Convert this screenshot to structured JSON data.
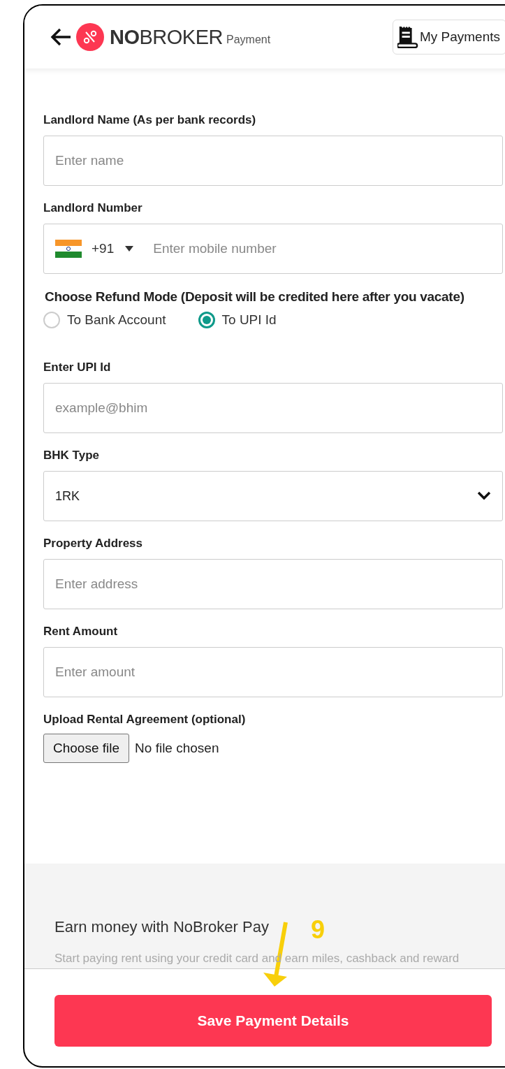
{
  "header": {
    "logo": "**NO**BROKER",
    "subtitle": "Payment",
    "my_payments": "My Payments"
  },
  "fields": [
    {
      "kind": "text",
      "label": "Landlord Name (As per bank records)",
      "placeholder": "Enter name"
    },
    {
      "kind": "phone",
      "label": "Landlord Number",
      "country_code": "+91",
      "placeholder": "Enter mobile number"
    },
    {
      "kind": "radio",
      "label": "Choose Refund Mode (Deposit will be credited here after you vacate)",
      "options": [
        {
          "label": "To Bank Account",
          "selected": false
        },
        {
          "label": "To UPI Id",
          "selected": true
        }
      ]
    },
    {
      "kind": "text",
      "label": "Enter UPI Id",
      "placeholder": "example@bhim"
    },
    {
      "kind": "select",
      "label": "BHK Type",
      "value": "1RK"
    },
    {
      "kind": "text",
      "label": "Property Address",
      "placeholder": "Enter address"
    },
    {
      "kind": "text",
      "label": "Rent Amount",
      "placeholder": "Enter amount"
    },
    {
      "kind": "file",
      "label": "Upload Rental Agreement (optional)",
      "button": "Choose file",
      "status": "No file chosen"
    }
  ],
  "promo": {
    "title": "Earn money with NoBroker Pay",
    "text": "Start paying rent using your credit card and earn miles, cashback and reward"
  },
  "annotation": {
    "label": "9"
  },
  "save_button": "Save Payment Details"
}
